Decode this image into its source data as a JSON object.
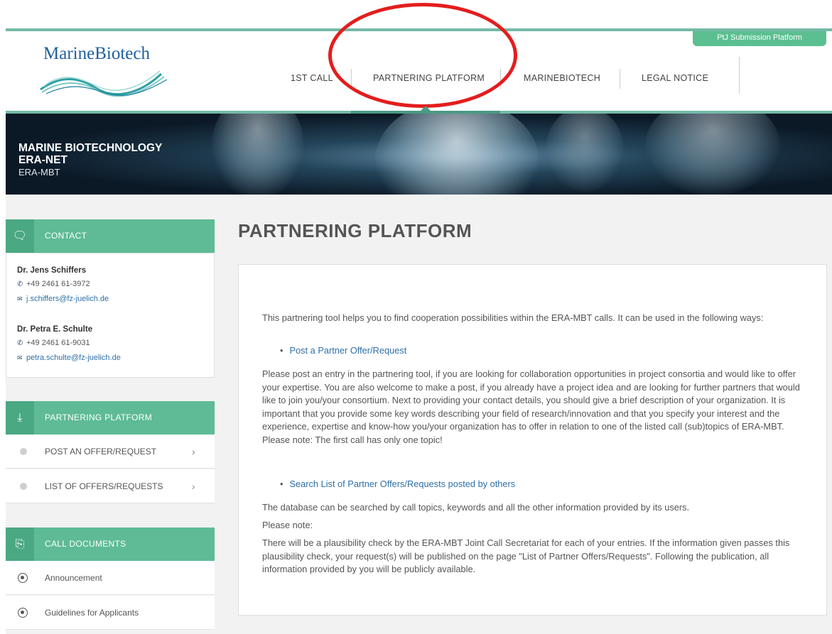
{
  "header": {
    "ptj_button": "PtJ Submission Platform",
    "logo_text": "MarineBiotech",
    "nav": [
      {
        "label": "1ST CALL"
      },
      {
        "label": "PARTNERING PLATFORM"
      },
      {
        "label": "MARINEBIOTECH"
      },
      {
        "label": "LEGAL NOTICE"
      }
    ],
    "active_nav": "PARTNERING PLATFORM",
    "highlight_color": "#e41d1d"
  },
  "banner": {
    "title_line1": "MARINE BIOTECHNOLOGY",
    "title_line2": "ERA-NET",
    "subtitle": "ERA-MBT"
  },
  "sidebar": {
    "contact": {
      "heading": "CONTACT",
      "people": [
        {
          "name": "Dr. Jens Schiffers",
          "phone": "+49 2461 61-3972",
          "email": "j.schiffers@fz-juelich.de"
        },
        {
          "name": "Dr. Petra E. Schulte",
          "phone": "+49 2461 61-9031",
          "email": "petra.schulte@fz-juelich.de"
        }
      ]
    },
    "partnering": {
      "heading": "PARTNERING PLATFORM",
      "items": [
        {
          "label": "POST AN OFFER/REQUEST"
        },
        {
          "label": "LIST OF OFFERS/REQUESTS"
        }
      ]
    },
    "documents": {
      "heading": "CALL DOCUMENTS",
      "items": [
        {
          "label": "Announcement"
        },
        {
          "label": "Guidelines for Applicants"
        }
      ]
    },
    "accent_color": "#5ebb95"
  },
  "main": {
    "title": "PARTNERING PLATFORM",
    "intro": "This partnering tool helps you to find cooperation possibilities within the ERA-MBT calls. It can be used in the following ways:",
    "link1": "Post a Partner Offer/Request",
    "para1": "Please post an entry in the partnering tool, if you are looking for collaboration opportunities in project consortia and would like to offer your expertise. You are also welcome to make a post, if you already have a project idea and are looking for further partners that would like to join you/your consortium. Next to providing your contact details, you should give a brief description of your organization. It is important that you provide some key words describing your field of research/innovation and that you specify your interest and the experience, expertise and know-how you/your organization has to offer in relation to one of the listed call (sub)topics of ERA-MBT. Please note: The first call has only one topic!",
    "link2": "Search List of Partner Offers/Requests posted by others",
    "para2": "The database can be searched by call topics, keywords and all the other information provided by its users.",
    "para3": "Please note:",
    "para4": "There will be a plausibility check by the ERA-MBT Joint Call Secretariat for each of your entries. If the information given passes this plausibility check, your request(s) will be published on the page \"List of Partner Offers/Requests\". Following the publication, all information provided by you will be publicly available."
  }
}
